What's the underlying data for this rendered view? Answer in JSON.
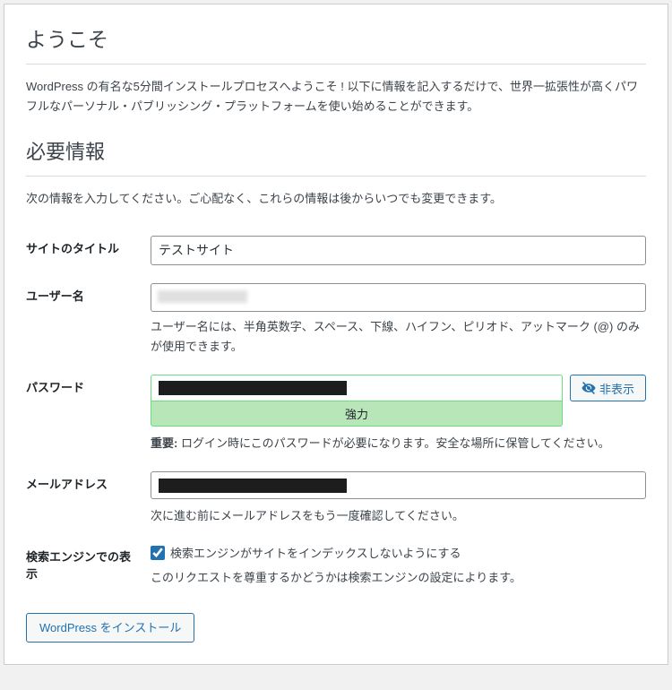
{
  "headings": {
    "welcome": "ようこそ",
    "required_info": "必要情報"
  },
  "intro": "WordPress の有名な5分間インストールプロセスへようこそ ! 以下に情報を記入するだけで、世界一拡張性が高くパワフルなパーソナル・パブリッシング・プラットフォームを使い始めることができます。",
  "info_note": "次の情報を入力してください。ご心配なく、これらの情報は後からいつでも変更できます。",
  "fields": {
    "site_title": {
      "label": "サイトのタイトル",
      "value": "テストサイト"
    },
    "username": {
      "label": "ユーザー名",
      "hint": "ユーザー名には、半角英数字、スペース、下線、ハイフン、ピリオド、アットマーク (@) のみが使用できます。"
    },
    "password": {
      "label": "パスワード",
      "strength": "強力",
      "hide_button": "非表示",
      "important_label": "重要:",
      "important_text": " ログイン時にこのパスワードが必要になります。安全な場所に保管してください。"
    },
    "email": {
      "label": "メールアドレス",
      "hint": "次に進む前にメールアドレスをもう一度確認してください。"
    },
    "search_engine": {
      "label": "検索エンジンでの表示",
      "checkbox_label": "検索エンジンがサイトをインデックスしないようにする",
      "hint": "このリクエストを尊重するかどうかは検索エンジンの設定によります。"
    }
  },
  "submit": {
    "label": "WordPress をインストール"
  }
}
